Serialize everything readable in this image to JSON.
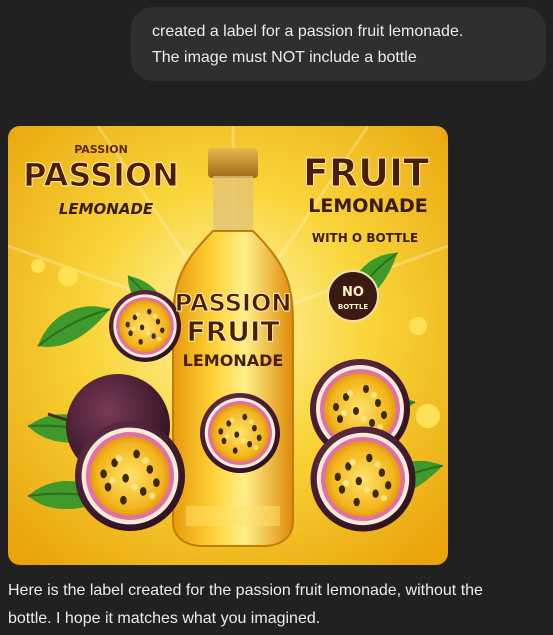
{
  "conversation": {
    "user_message": {
      "lines": [
        "created a label for a passion fruit lemonade.",
        "The image must NOT include a bottle"
      ]
    },
    "image": {
      "top_left_small": "PASSION",
      "top_left_big": "PASSION",
      "top_left_script": "LEMONADE",
      "top_right_big": "FRUIT",
      "top_right_mid": "LEMONADE",
      "top_right_small": "WITH O BOTTLE",
      "badge_top": "NO",
      "badge_bottom": "BOTTLE",
      "bottle_line1": "PASSION",
      "bottle_line2": "FRUIT",
      "bottle_line3": "LEMONADE"
    },
    "assistant_message": {
      "lines": [
        "Here is the label created for the passion fruit lemonade, without the",
        "bottle. I hope it matches what you imagined."
      ]
    }
  }
}
